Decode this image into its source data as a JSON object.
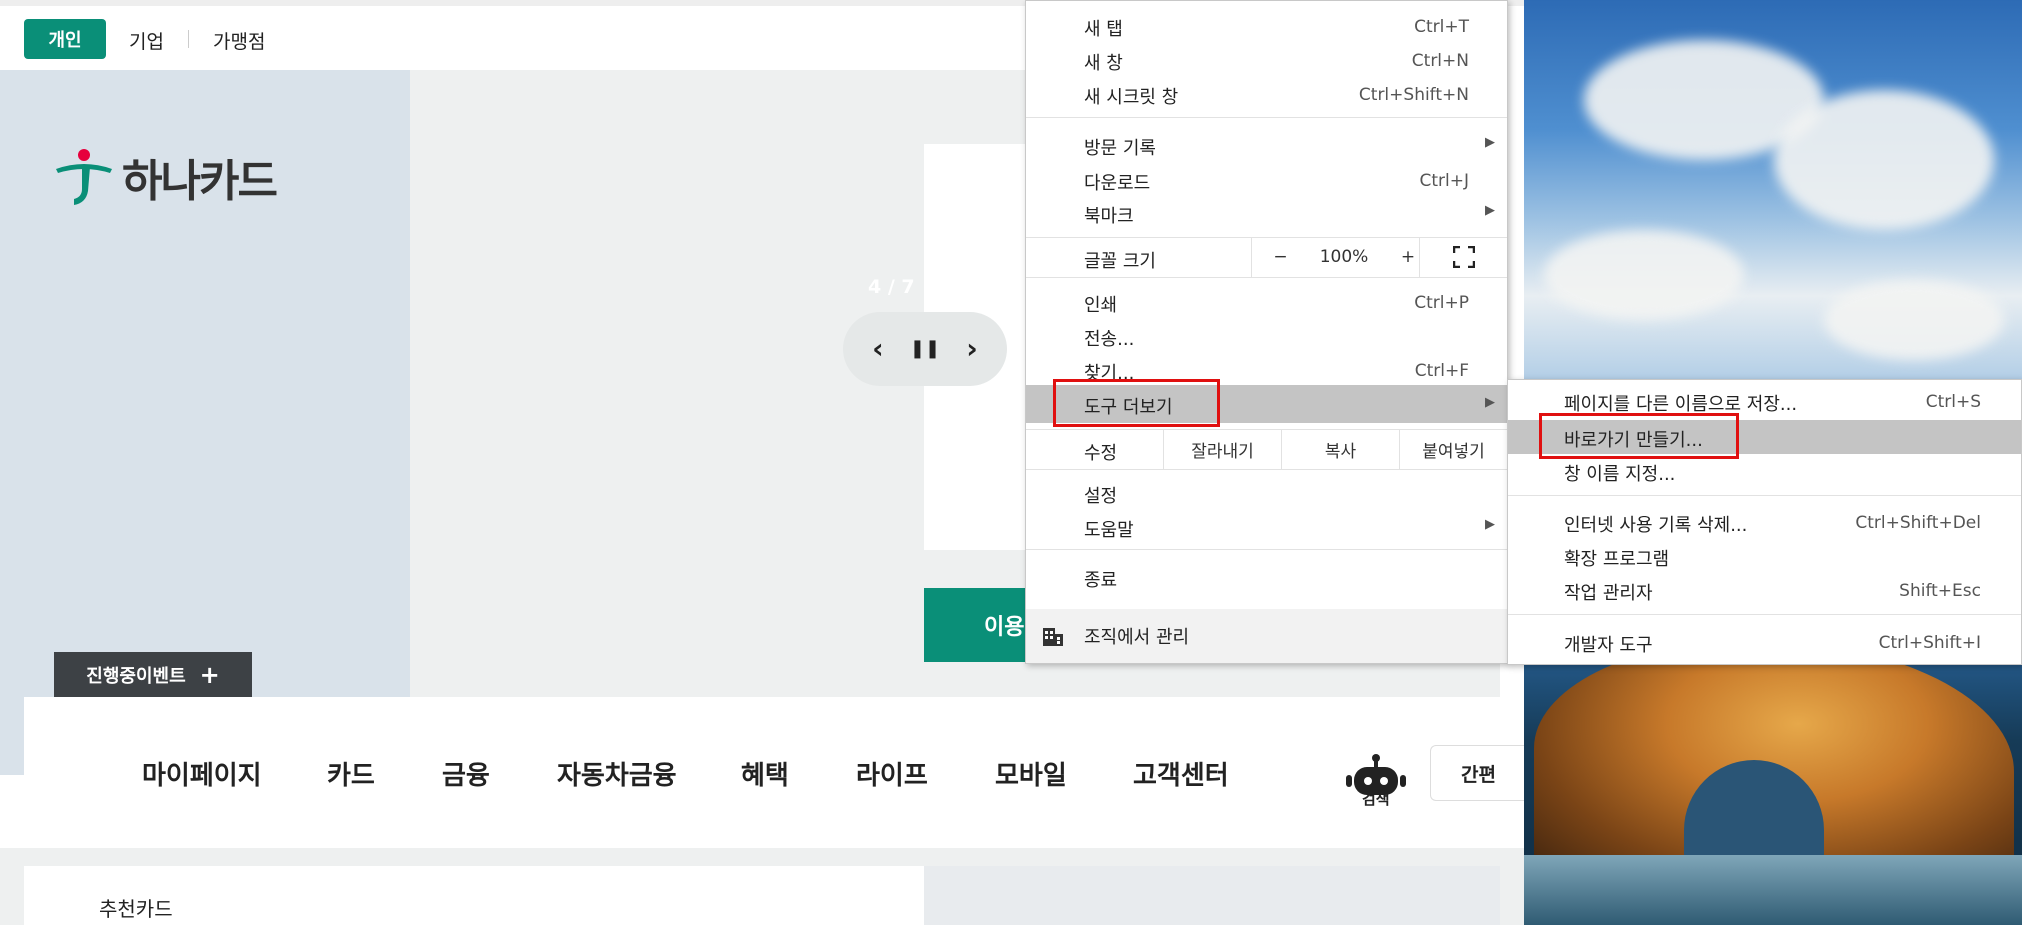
{
  "top_tabs": {
    "personal": "개인",
    "corporate": "기업",
    "merchant": "가맹점"
  },
  "logo": {
    "text": "하나카드"
  },
  "slider": {
    "counter": "4 / 7",
    "prev_icon": "‹",
    "pause_icon": "❚❚",
    "next_icon": "›"
  },
  "teal_button": {
    "label": "이용"
  },
  "event_bar": {
    "label": "진행중이벤트",
    "plus": "+"
  },
  "nav": {
    "items": [
      "마이페이지",
      "카드",
      "금융",
      "자동차금융",
      "혜택",
      "라이프",
      "모바일",
      "고객센터"
    ],
    "search_label": "검색",
    "quick_label": "간편"
  },
  "recommend": {
    "title": "추천카드"
  },
  "chrome_menu": {
    "new_tab": {
      "label": "새 탭",
      "shortcut": "Ctrl+T"
    },
    "new_window": {
      "label": "새 창",
      "shortcut": "Ctrl+N"
    },
    "new_incognito": {
      "label": "새 시크릿 창",
      "shortcut": "Ctrl+Shift+N"
    },
    "history": {
      "label": "방문 기록"
    },
    "downloads": {
      "label": "다운로드",
      "shortcut": "Ctrl+J"
    },
    "bookmarks": {
      "label": "북마크"
    },
    "zoom": {
      "label": "글꼴 크기",
      "minus": "−",
      "value": "100%",
      "plus": "+"
    },
    "print": {
      "label": "인쇄",
      "shortcut": "Ctrl+P"
    },
    "cast": {
      "label": "전송..."
    },
    "find": {
      "label": "찾기...",
      "shortcut": "Ctrl+F"
    },
    "more_tools": {
      "label": "도구 더보기"
    },
    "edit": {
      "label": "수정",
      "cut": "잘라내기",
      "copy": "복사",
      "paste": "붙여넣기"
    },
    "settings": {
      "label": "설정"
    },
    "help": {
      "label": "도움말"
    },
    "exit": {
      "label": "종료"
    },
    "managed": {
      "label": "조직에서 관리"
    }
  },
  "submenu": {
    "save_page": {
      "label": "페이지를 다른 이름으로 저장...",
      "shortcut": "Ctrl+S"
    },
    "create_shortcut": {
      "label": "바로가기 만들기..."
    },
    "name_window": {
      "label": "창 이름 지정..."
    },
    "clear_data": {
      "label": "인터넷 사용 기록 삭제...",
      "shortcut": "Ctrl+Shift+Del"
    },
    "extensions": {
      "label": "확장 프로그램"
    },
    "task_manager": {
      "label": "작업 관리자",
      "shortcut": "Shift+Esc"
    },
    "dev_tools": {
      "label": "개발자 도구",
      "shortcut": "Ctrl+Shift+I"
    }
  },
  "colors": {
    "brand": "#0a8f78",
    "highlight_box": "#e01010"
  }
}
